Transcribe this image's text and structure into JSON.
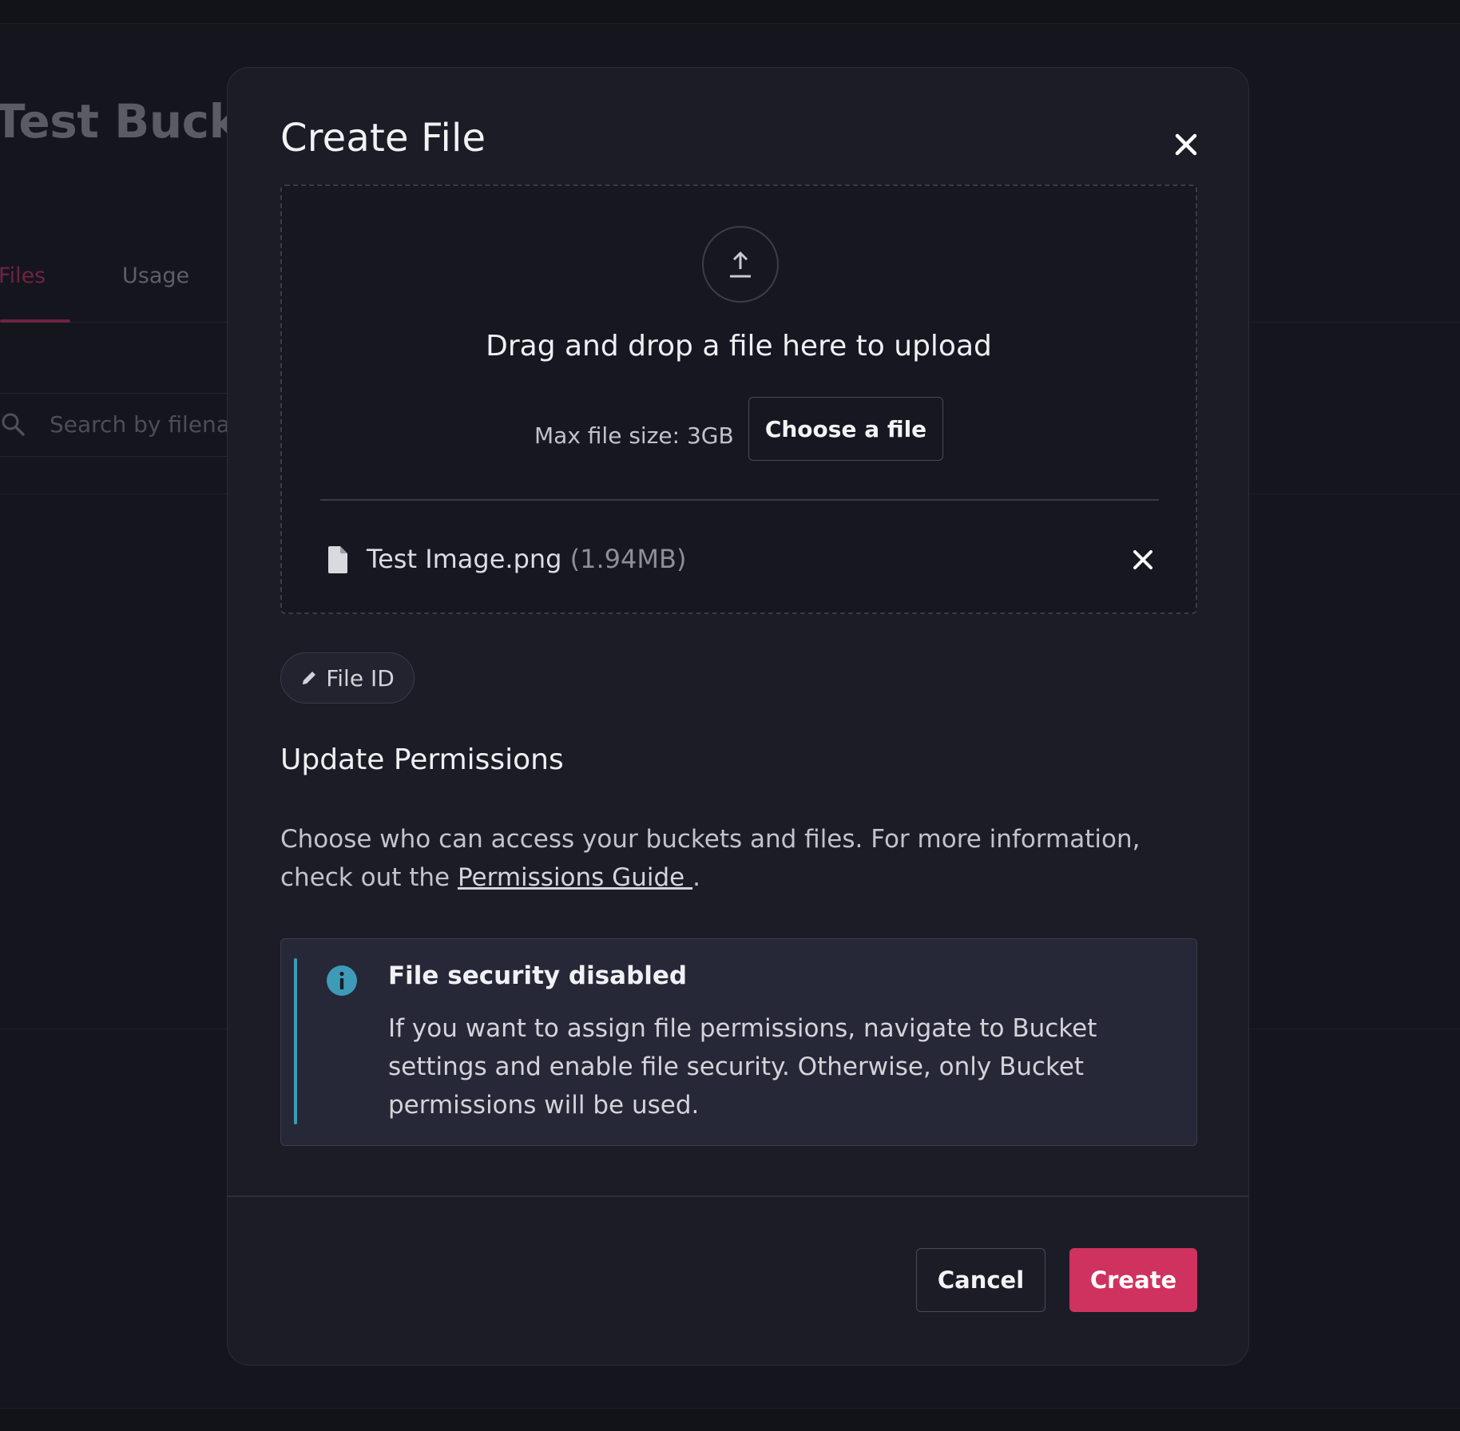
{
  "background": {
    "bucket_title": "Test Bucket",
    "tabs": [
      {
        "label": "Files",
        "active": true
      },
      {
        "label": "Usage",
        "active": false
      }
    ],
    "search_placeholder": "Search by filename"
  },
  "modal": {
    "title": "Create File",
    "close_icon": "close-icon",
    "dropzone": {
      "upload_icon": "upload-icon",
      "heading": "Drag and drop a file here to upload",
      "max_size": "Max file size: 3GB",
      "choose_label": "Choose a file",
      "file": {
        "icon": "file-icon",
        "name": "Test Image.png",
        "size": "(1.94MB)"
      }
    },
    "file_id_label": "File ID",
    "permissions": {
      "title": "Update Permissions",
      "description_before": "Choose who can access your buckets and files. For more information, check out the ",
      "guide_link": "Permissions Guide ",
      "description_after": "."
    },
    "alert": {
      "icon": "info-icon",
      "title": "File security disabled",
      "body": "If you want to assign file permissions, navigate to Bucket settings and enable file security. Otherwise, only Bucket permissions will be used."
    },
    "footer": {
      "cancel_label": "Cancel",
      "create_label": "Create"
    }
  },
  "colors": {
    "accent": "#d0325f",
    "info": "#3d9bb8",
    "background": "#15151e",
    "modal": "#1c1c27"
  }
}
